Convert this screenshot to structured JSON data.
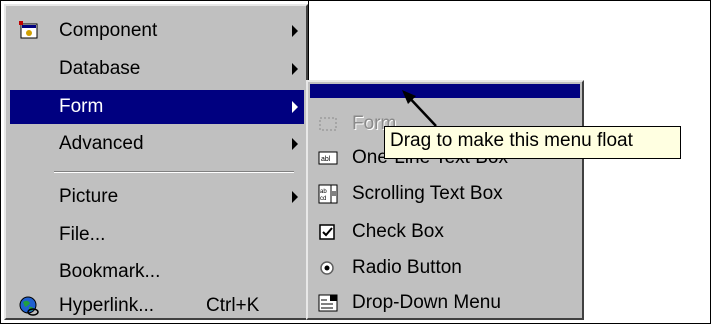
{
  "main_menu": {
    "items": [
      {
        "label": "Component",
        "has_submenu": true,
        "icon": "component-icon"
      },
      {
        "label": "Database",
        "has_submenu": true
      },
      {
        "label": "Form",
        "has_submenu": true,
        "highlighted": true
      },
      {
        "label": "Advanced",
        "has_submenu": true
      },
      {
        "label": "Picture",
        "has_submenu": true
      },
      {
        "label": "File...",
        "has_submenu": false
      },
      {
        "label": "Bookmark...",
        "has_submenu": false
      },
      {
        "label": "Hyperlink...",
        "shortcut": "Ctrl+K",
        "icon": "globe-link-icon"
      }
    ]
  },
  "form_submenu": {
    "items": [
      {
        "label": "Form",
        "icon": "form-icon",
        "disabled": true
      },
      {
        "label": "One-Line Text Box",
        "icon": "text-box-icon"
      },
      {
        "label": "Scrolling Text Box",
        "icon": "scrolling-text-box-icon"
      },
      {
        "label": "Check Box",
        "icon": "check-box-icon"
      },
      {
        "label": "Radio Button",
        "icon": "radio-button-icon"
      },
      {
        "label": "Drop-Down Menu",
        "icon": "drop-down-menu-icon"
      }
    ]
  },
  "tooltip": {
    "text": "Drag to make this menu float"
  },
  "colors": {
    "menu_bg": "#c0c0c0",
    "highlight": "#000080",
    "tooltip_bg": "#ffffe1"
  }
}
